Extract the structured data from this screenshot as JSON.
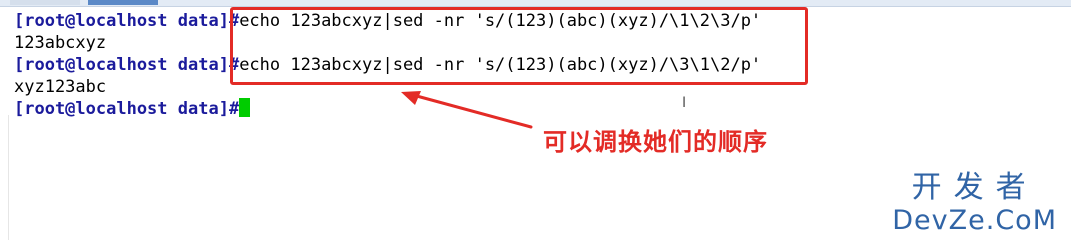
{
  "terminal": {
    "lines": [
      {
        "prompt": "[root@localhost data]",
        "hash": "#",
        "command": "echo 123abcxyz|sed -nr 's/(123)(abc)(xyz)/\\1\\2\\3/p'"
      },
      {
        "output": "123abcxyz"
      },
      {
        "prompt": "[root@localhost data]",
        "hash": "#",
        "command": "echo 123abcxyz|sed -nr 's/(123)(abc)(xyz)/\\3\\1\\2/p'"
      },
      {
        "output": "xyz123abc"
      },
      {
        "prompt": "[root@localhost data]",
        "hash": "#"
      }
    ]
  },
  "annotation": {
    "text": "可以调换她们的顺序",
    "color": "#e32b26"
  },
  "watermark": {
    "cn": "开发者",
    "en": "DevZe.CoM"
  },
  "colors": {
    "prompt": "#1b1b9c",
    "cursor": "#00cc00",
    "highlight_box": "#e32b26",
    "watermark": "#3064a6"
  }
}
